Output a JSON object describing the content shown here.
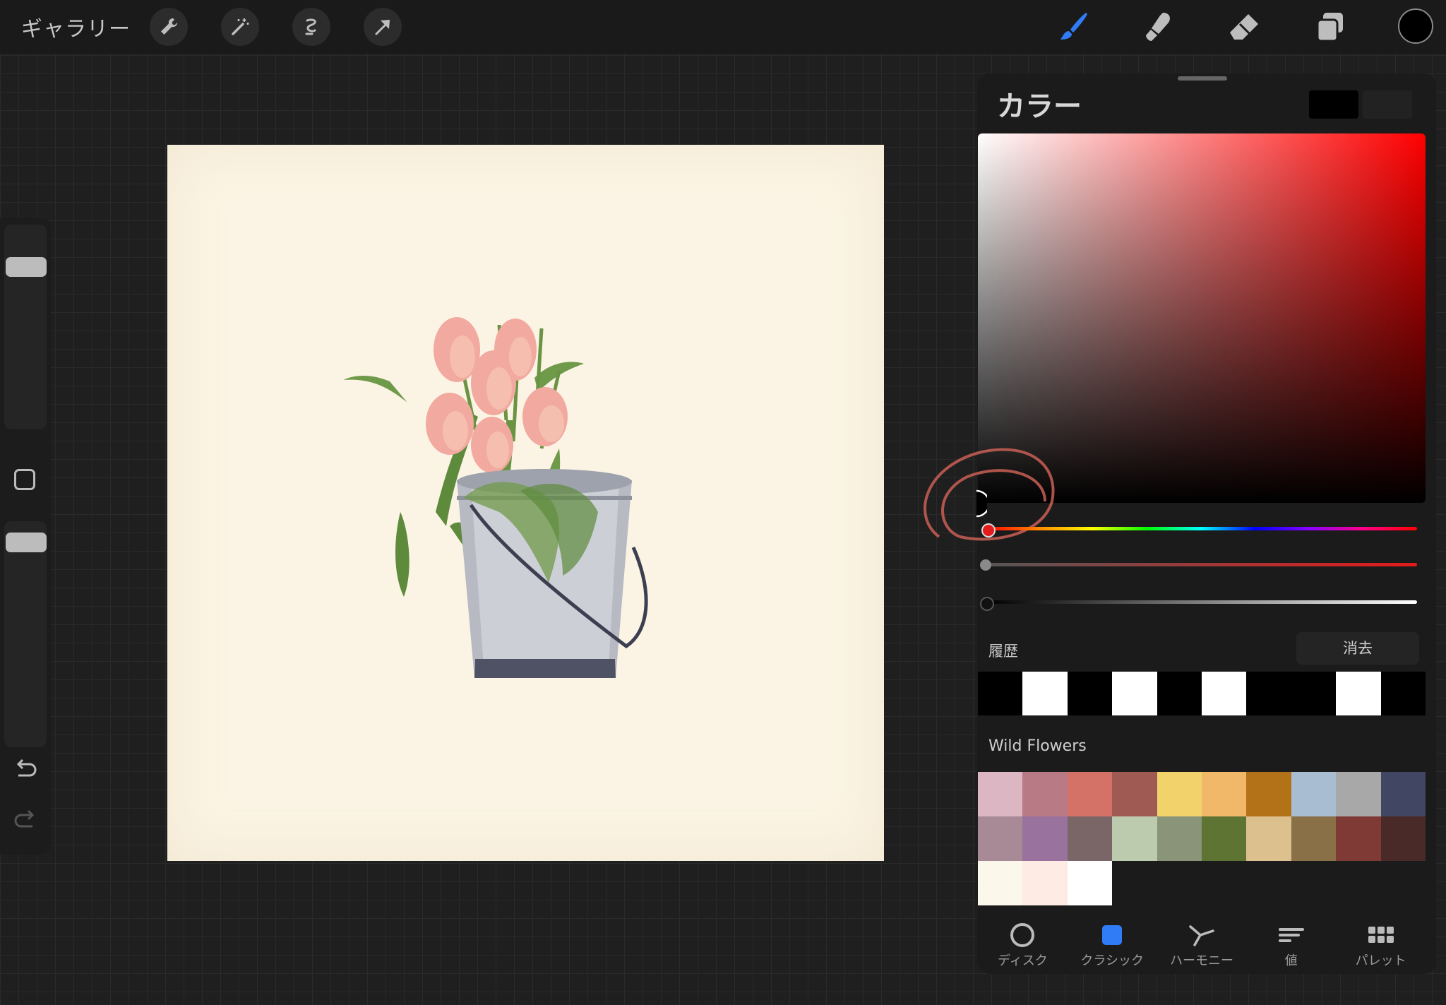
{
  "toolbar": {
    "gallery_label": "ギャラリー",
    "left_tools": [
      {
        "name": "wrench-icon"
      },
      {
        "name": "magic-wand-icon"
      },
      {
        "name": "selection-icon"
      },
      {
        "name": "transform-arrow-icon"
      }
    ],
    "right_tools": [
      {
        "name": "brush-icon",
        "active": true,
        "color": "#2f7cf6"
      },
      {
        "name": "smudge-icon"
      },
      {
        "name": "eraser-icon"
      },
      {
        "name": "layers-icon"
      }
    ],
    "current_color": "#000000"
  },
  "sidebar": {
    "size_slider": "brush-size",
    "opacity_slider": "brush-opacity",
    "modify_button": "modify-square-icon",
    "undo": "undo-icon",
    "redo": "redo-icon"
  },
  "canvas": {
    "background": "#fbf4e4",
    "artwork": "watercolor tulips in metal bucket"
  },
  "color_panel": {
    "title": "カラー",
    "primary_swatch": "#000000",
    "secondary_swatch": "#222222",
    "history_label": "履歴",
    "clear_label": "消去",
    "history": [
      "#000000",
      "#ffffff",
      "#000000",
      "#ffffff",
      "#000000",
      "#ffffff",
      "#000000",
      "#000000",
      "#ffffff",
      "#000000"
    ],
    "palette_name": "Wild Flowers",
    "palette": [
      "#dcb6c2",
      "#b87a84",
      "#d47268",
      "#a05a54",
      "#f2d26a",
      "#f2b86a",
      "#b37218",
      "#a8bcd2",
      "#a8a8a8",
      "#414662",
      "#a88a96",
      "#9a729e",
      "#7a6666",
      "#bccaae",
      "#8a9478",
      "#5e7432",
      "#dcc08e",
      "#8a7046",
      "#803a36",
      "#4a2a28",
      "#fbf7ea",
      "#fdebe4",
      "#ffffff"
    ],
    "tabs": [
      {
        "label": "ディスク",
        "icon": "disc-icon",
        "active": false
      },
      {
        "label": "クラシック",
        "icon": "classic-square-icon",
        "active": true
      },
      {
        "label": "ハーモニー",
        "icon": "harmony-icon",
        "active": false
      },
      {
        "label": "値",
        "icon": "value-sliders-icon",
        "active": false
      },
      {
        "label": "パレット",
        "icon": "palette-grid-icon",
        "active": false
      }
    ],
    "accent_color": "#2f7cf6"
  }
}
